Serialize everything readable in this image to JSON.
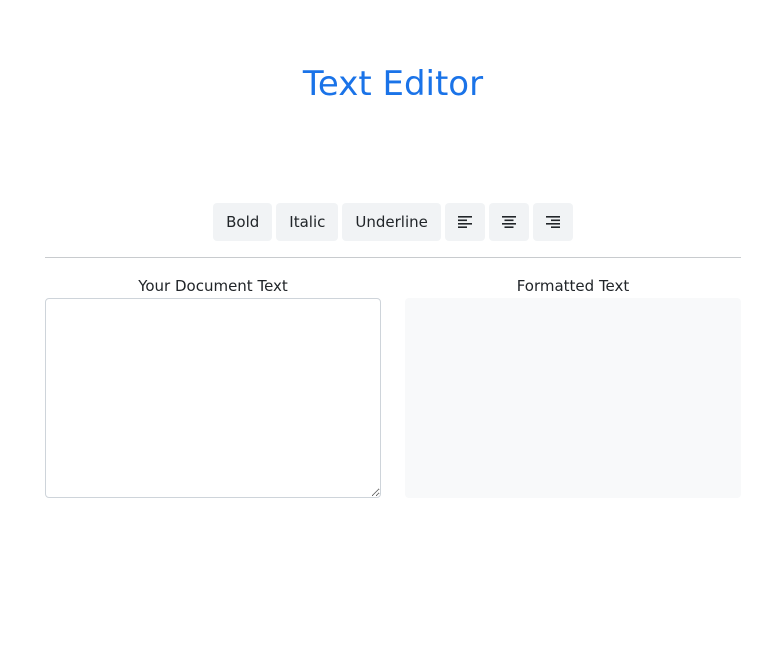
{
  "header": {
    "title": "Text Editor"
  },
  "toolbar": {
    "bold_label": "Bold",
    "italic_label": "Italic",
    "underline_label": "Underline",
    "icons": [
      "align-left-icon",
      "align-center-icon",
      "align-right-icon"
    ]
  },
  "editor": {
    "label": "Your Document Text",
    "value": "",
    "placeholder": ""
  },
  "preview": {
    "label": "Formatted Text",
    "content": ""
  },
  "colors": {
    "accent": "#1a73e8",
    "button_bg": "#f1f3f5",
    "preview_bg": "#f8f9fa"
  }
}
